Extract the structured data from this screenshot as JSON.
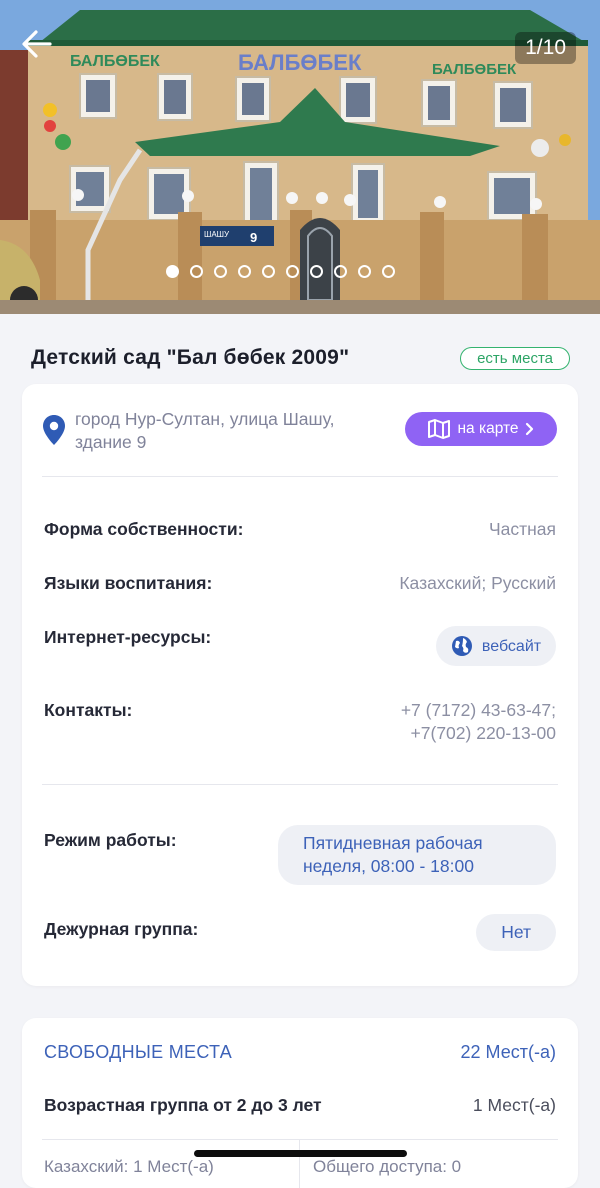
{
  "gallery": {
    "counter": "1/10",
    "total_photos": 10,
    "active_index": 0,
    "sign_text": "БАЛБӨБЕК",
    "street_plate": "ШАШУ",
    "street_number": "9"
  },
  "header": {
    "title": "Детский сад \"Бал бөбек 2009\"",
    "badge": "есть места"
  },
  "address": {
    "line1": "город Нур-Султан, улица Шашу,",
    "line2": "здание 9",
    "map_button": "на карте"
  },
  "details": {
    "ownership_label": "Форма собственности:",
    "ownership_value": "Частная",
    "languages_label": "Языки воспитания:",
    "languages_value": "Казахский; Русский",
    "internet_label": "Интернет-ресурсы:",
    "website_button": "вебсайт",
    "contacts_label": "Контакты:",
    "contacts_line1": "+7 (7172) 43-63-47;",
    "contacts_line2": "+7(702) 220-13-00",
    "mode_label": "Режим работы:",
    "mode_line1": "Пятидневная рабочая",
    "mode_line2": "неделя, 08:00 - 18:00",
    "duty_label": "Дежурная группа:",
    "duty_value": "Нет"
  },
  "places": {
    "title": "СВОБОДНЫЕ МЕСТА",
    "count": "22 Мест(-а)",
    "group_label": "Возрастная группа от 2 до 3 лет",
    "group_count": "1 Мест(-а)",
    "kazakh": "Казахский: 1 Мест(-а)",
    "general": "Общего доступа: 0"
  },
  "colors": {
    "accent_blue": "#3d62b8",
    "map_purple": "#8f63f4",
    "badge_green": "#2da566"
  }
}
